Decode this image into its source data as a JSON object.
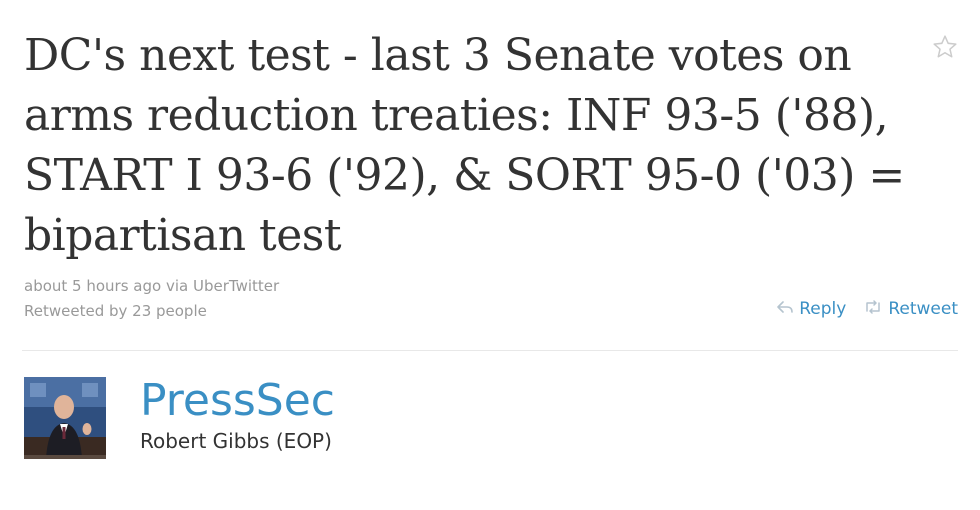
{
  "tweet": {
    "text": "DC's next test - last 3 Senate votes on arms reduction treaties: INF 93-5 ('88), START I 93-6 ('92), & SORT 95-0 ('03) = bipartisan test",
    "time": "about 5 hours ago",
    "via_prefix": "via",
    "via_app": "UberTwitter",
    "retweeted_by": "Retweeted by 23 people",
    "favorite_icon": "star-outline-icon"
  },
  "actions": {
    "reply_label": "Reply",
    "retweet_label": "Retweet",
    "reply_icon": "reply-arrow-icon",
    "retweet_icon": "retweet-arrows-icon"
  },
  "author": {
    "screen_name": "PressSec",
    "full_name": "Robert Gibbs (EOP)",
    "avatar_icon": "profile-photo"
  },
  "colors": {
    "link": "#3a8fc4",
    "text": "#333333",
    "meta": "#999999",
    "divider": "#e8e8e8"
  }
}
